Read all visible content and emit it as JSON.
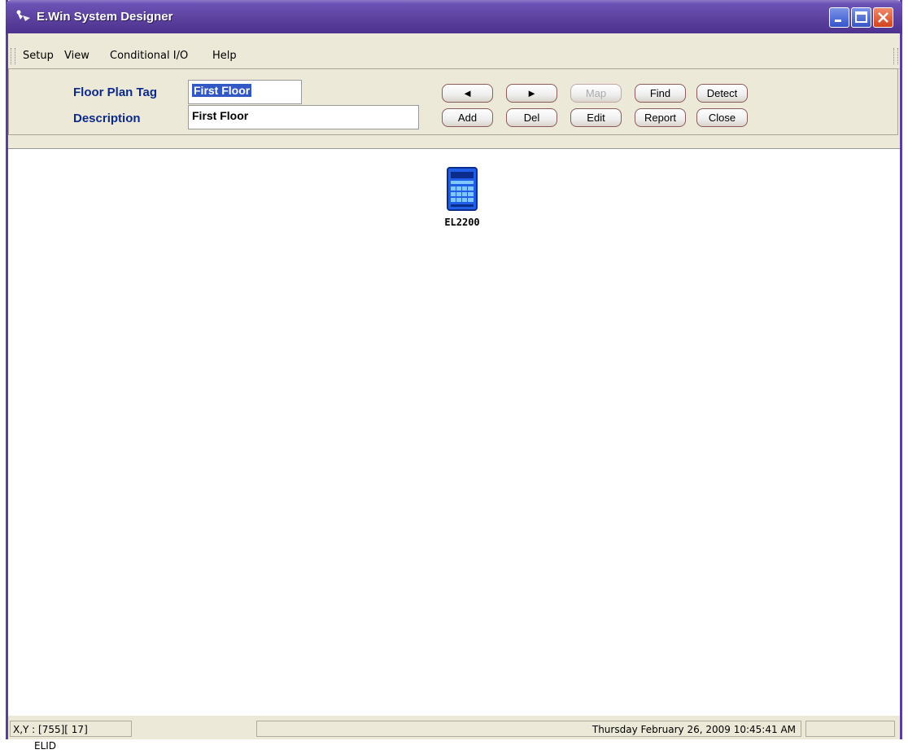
{
  "window": {
    "title": "E.Win System Designer"
  },
  "menu": {
    "items": [
      "Setup",
      "View",
      "Conditional I/O",
      "Help"
    ]
  },
  "toolbar": {
    "floor_plan_label": "Floor Plan Tag",
    "floor_plan_value": "First Floor",
    "description_label": "Description",
    "description_value": "First Floor",
    "buttons": {
      "prev": "◄",
      "next": "►",
      "map": "Map",
      "find": "Find",
      "detect": "Detect",
      "add": "Add",
      "del": "Del",
      "edit": "Edit",
      "report": "Report",
      "close": "Close"
    }
  },
  "canvas": {
    "device_label": "EL2200"
  },
  "status": {
    "coords": "X,Y : [755][ 17]",
    "mode": "ELID",
    "datetime": "Thursday February 26, 2009 10:45:41 AM"
  },
  "colors": {
    "title_bar": "#5b3f9c",
    "label_blue": "#0c2a8c",
    "device_blue": "#1f5fe8"
  }
}
